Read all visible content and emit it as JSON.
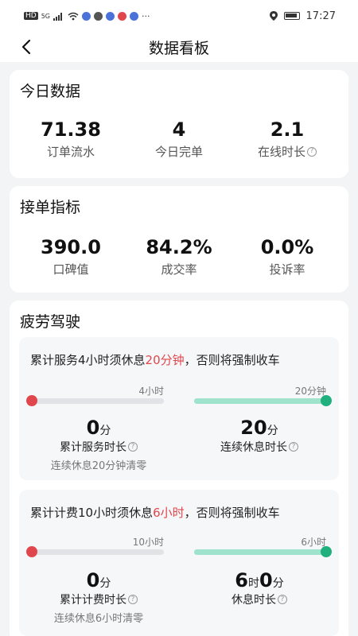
{
  "status_bar": {
    "network": "HD",
    "signal": "5G",
    "time": "17:27"
  },
  "nav": {
    "title": "数据看板"
  },
  "today": {
    "title": "今日数据",
    "metrics": [
      {
        "value": "71.38",
        "label": "订单流水",
        "help": false
      },
      {
        "value": "4",
        "label": "今日完单",
        "help": false
      },
      {
        "value": "2.1",
        "label": "在线时长",
        "help": true
      }
    ]
  },
  "indicators": {
    "title": "接单指标",
    "metrics": [
      {
        "value": "390.0",
        "label": "口碑值"
      },
      {
        "value": "84.2%",
        "label": "成交率"
      },
      {
        "value": "0.0%",
        "label": "投诉率"
      }
    ]
  },
  "fatigue": {
    "title": "疲劳驾驶",
    "help_glyph": "?",
    "blocks": [
      {
        "rule_prefix": "累计服务4小时须休息",
        "rule_highlight": "20分钟",
        "rule_suffix": "，否则将强制收车",
        "left_caption": "4小时",
        "left_progress": 0.0,
        "right_caption": "20分钟",
        "right_progress": 1.0,
        "left_value": "0",
        "left_unit": "分",
        "left_label": "累计服务时长",
        "left_note": "连续休息20分钟清零",
        "right_value": "20",
        "right_unit": "分",
        "right_label": "连续休息时长"
      },
      {
        "rule_prefix": "累计计费10小时须休息",
        "rule_highlight": "6小时",
        "rule_suffix": "，否则将强制收车",
        "left_caption": "10小时",
        "left_progress": 0.0,
        "right_caption": "6小时",
        "right_progress": 1.0,
        "left_value": "0",
        "left_unit": "分",
        "left_label": "累计计费时长",
        "left_note": "连续休息6小时清零",
        "right_value_h": "6",
        "right_unit_h": "时",
        "right_value_m": "0",
        "right_unit_m": "分",
        "right_label": "休息时长"
      }
    ]
  },
  "colors": {
    "accent_red": "#e0474c",
    "progress_green": "#1fb07e",
    "progress_green_light": "#9fe3cd"
  }
}
